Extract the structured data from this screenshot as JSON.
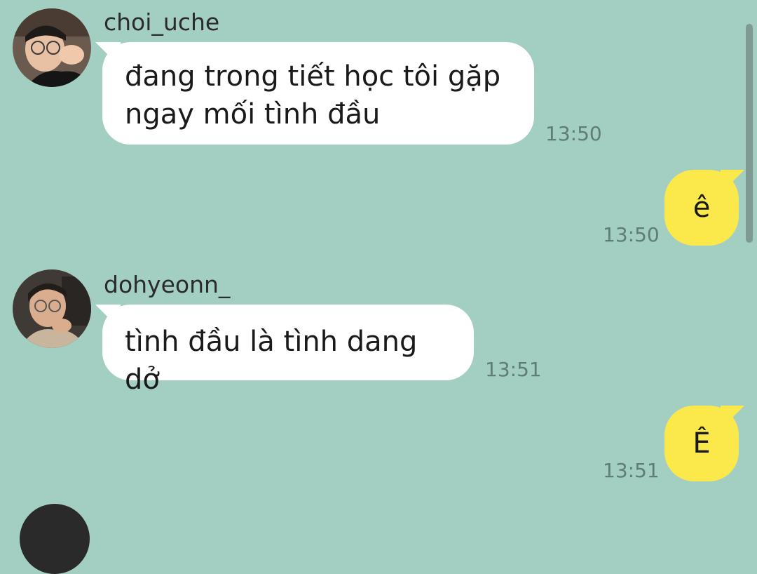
{
  "messages": [
    {
      "sender": "choi_uche",
      "text": "đang trong tiết học tôi gặp ngay mối tình đầu",
      "time": "13:50"
    },
    {
      "outgoing": true,
      "text": "ê",
      "time": "13:50"
    },
    {
      "sender": "dohyeonn_",
      "text": "tình đầu là tình dang dở",
      "time": "13:51"
    },
    {
      "outgoing": true,
      "text": "Ê",
      "time": "13:51"
    }
  ],
  "colors": {
    "background": "#a3cec2",
    "incoming_bubble": "#ffffff",
    "outgoing_bubble": "#fbe94b",
    "timestamp": "#5f7d76"
  }
}
